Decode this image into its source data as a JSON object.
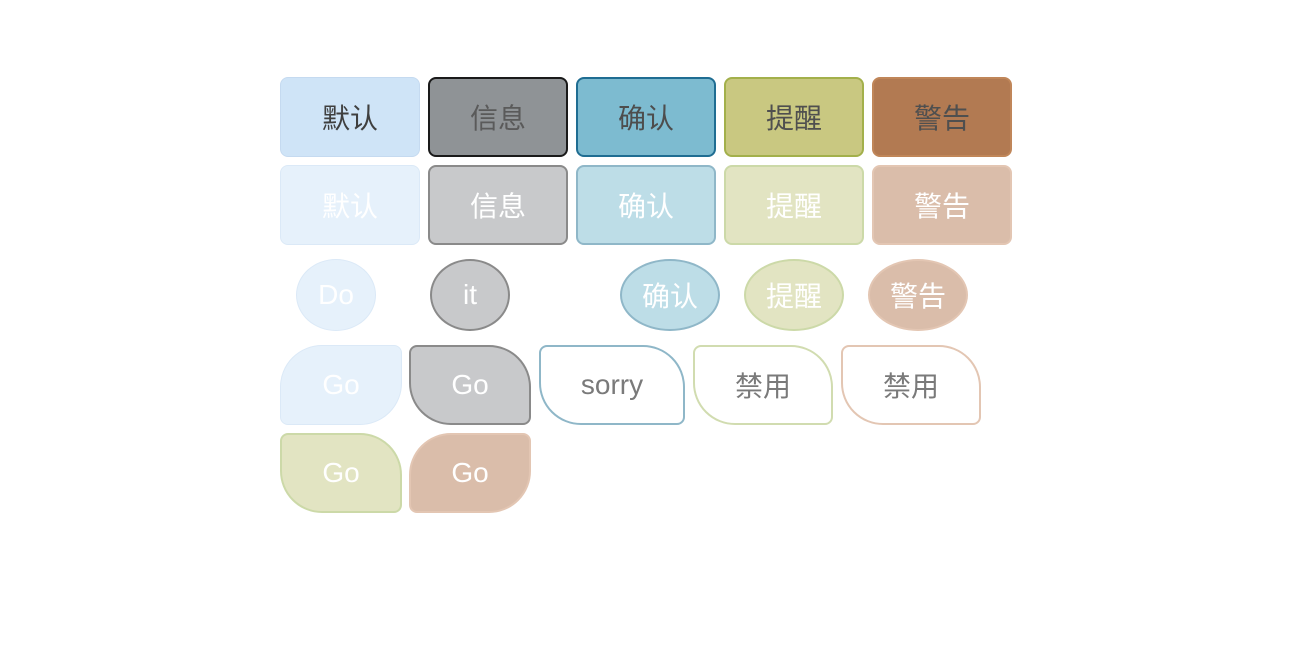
{
  "rows": {
    "row1": {
      "default": "默认",
      "info": "信息",
      "confirm": "确认",
      "remind": "提醒",
      "warn": "警告"
    },
    "row2": {
      "default": "默认",
      "info": "信息",
      "confirm": "确认",
      "remind": "提醒",
      "warn": "警告"
    },
    "row3": {
      "default": "Do",
      "info": "it",
      "confirm": "确认",
      "remind": "提醒",
      "warn": "警告"
    },
    "row4": {
      "default": "Go",
      "info": "Go",
      "confirm": "sorry",
      "remind": "禁用",
      "warn": "禁用"
    },
    "row5": {
      "remind": "Go",
      "warn": "Go"
    }
  },
  "colors": {
    "default": "#cfe4f7",
    "info": "#8f9396",
    "confirm": "#7dbbd0",
    "remind": "#c9c881",
    "warn": "#b27a52"
  }
}
